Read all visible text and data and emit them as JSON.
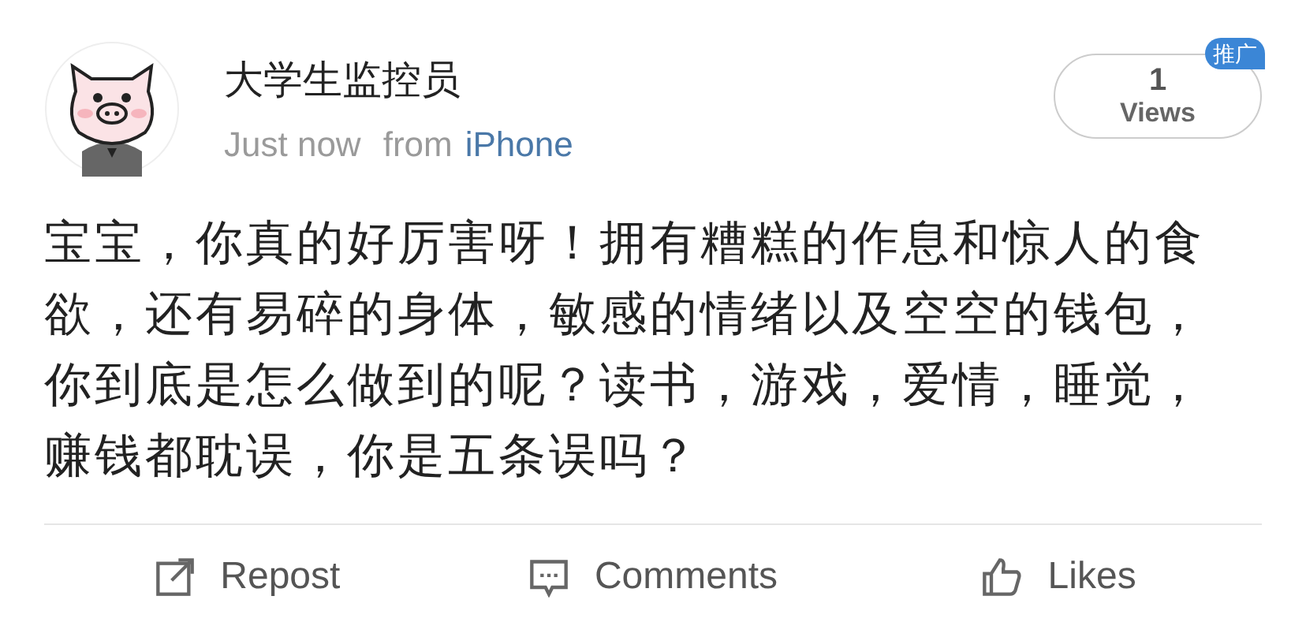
{
  "author": {
    "name": "大学生监控员",
    "time": "Just now",
    "source_prefix": "from",
    "source": "iPhone"
  },
  "views": {
    "count": "1",
    "label": "Views",
    "badge": "推广"
  },
  "post": {
    "text": "宝宝，你真的好厉害呀！拥有糟糕的作息和惊人的食欲，还有易碎的身体，敏感的情绪以及空空的钱包，你到底是怎么做到的呢？读书，游戏，爱情，睡觉，赚钱都耽误，你是五条误吗？"
  },
  "actions": [
    {
      "kind": "repost",
      "label": "Repost"
    },
    {
      "kind": "comments",
      "label": "Comments"
    },
    {
      "kind": "like",
      "label": "Likes"
    }
  ]
}
